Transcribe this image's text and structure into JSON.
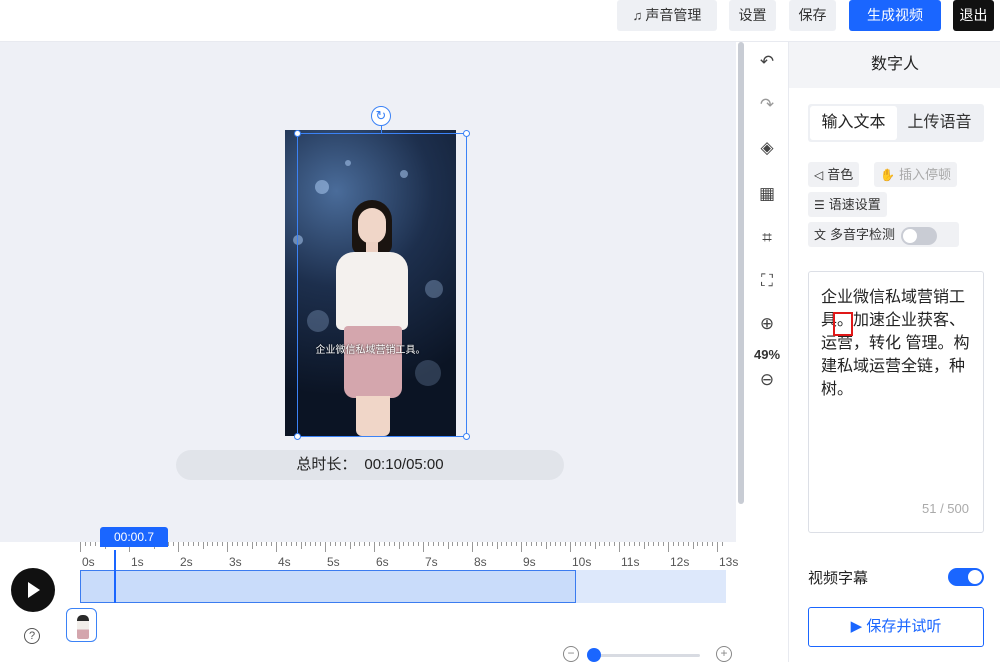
{
  "topbar": {
    "voice_manage": "声音管理",
    "settings": "设置",
    "save": "保存",
    "generate": "生成视频",
    "exit": "退出"
  },
  "canvas": {
    "subtitle": "企业微信私域营销工具。",
    "duration_label": "总时长：",
    "duration_value": "00:10/05:00"
  },
  "tools": {
    "zoom": "49%"
  },
  "panel": {
    "title": "数字人",
    "tabs": [
      "输入文本",
      "上传语音"
    ],
    "chips": {
      "timbre": "音色",
      "pause": "插入停顿",
      "speed": "语速设置",
      "polyphone": "多音字检测"
    },
    "text": "企业微信私域营销工具。加速企业获客、运营，转化 管理。构建私域运营全链，种树。",
    "counter": "51 / 500",
    "subtitle_label": "视频字幕",
    "save_listen": "保存并试听"
  },
  "timeline": {
    "current_time": "00:00.7",
    "labels": [
      "0s",
      "1s",
      "2s",
      "3s",
      "4s",
      "5s",
      "6s",
      "7s",
      "8s",
      "9s",
      "10s",
      "11s",
      "12s",
      "13s"
    ],
    "help": "?"
  }
}
